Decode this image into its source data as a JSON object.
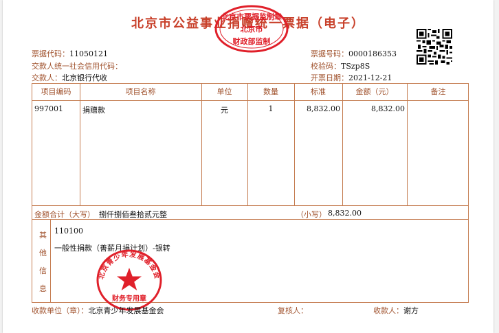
{
  "title": "北京市公益事业捐赠统一票据（电子）",
  "left_info": {
    "code_label": "票据代码：",
    "code_value": "11050121",
    "credit_label": "交款人统一社会信用代码：",
    "credit_value": "",
    "payer_label": "交款人：",
    "payer_value": "北京银行代收"
  },
  "right_info": {
    "number_label": "票据号码：",
    "number_value": "0000186353",
    "check_label": "校验码：",
    "check_value": "TSzp8S",
    "date_label": "开票日期：",
    "date_value": "2021-12-21"
  },
  "table": {
    "headers": [
      "项目编码",
      "项目名称",
      "单位",
      "数量",
      "标准",
      "金额（元）",
      "备注"
    ],
    "rows": [
      {
        "code": "997001",
        "name": "捐赠款",
        "unit": "元",
        "qty": "1",
        "standard": "8,832.00",
        "amount": "8,832.00",
        "note": ""
      }
    ],
    "total_upper_label": "金额合计（大写）",
    "total_upper_value": "捌仟捌佰叁拾贰元整",
    "total_lower_label": "（小写）",
    "total_lower_value": "8,832.00",
    "other_label": [
      "其",
      "他",
      "信",
      "息"
    ],
    "other_line1": "110100",
    "other_line2": "一般性捐款（善薪月捐计划）-银转"
  },
  "footer": {
    "receiver_label": "收款单位（章）：",
    "receiver_value": "北京青少年发展基金会",
    "reviewer_label": "复核人：",
    "reviewer_value": "",
    "payee_label": "收款人：",
    "payee_value": "谢方"
  },
  "seals": {
    "top_upper": "北京市票据监制章",
    "top_mid": "北京市",
    "top_lower": "财政部监制",
    "bottom_ring": "北京青少年发展基金会",
    "bottom_lower": "财务专用章"
  },
  "colors": {
    "title_red": "#c8402a",
    "label_brown": "#a0522d",
    "seal_red": "#e0202a",
    "rule": "#c47b4f"
  }
}
